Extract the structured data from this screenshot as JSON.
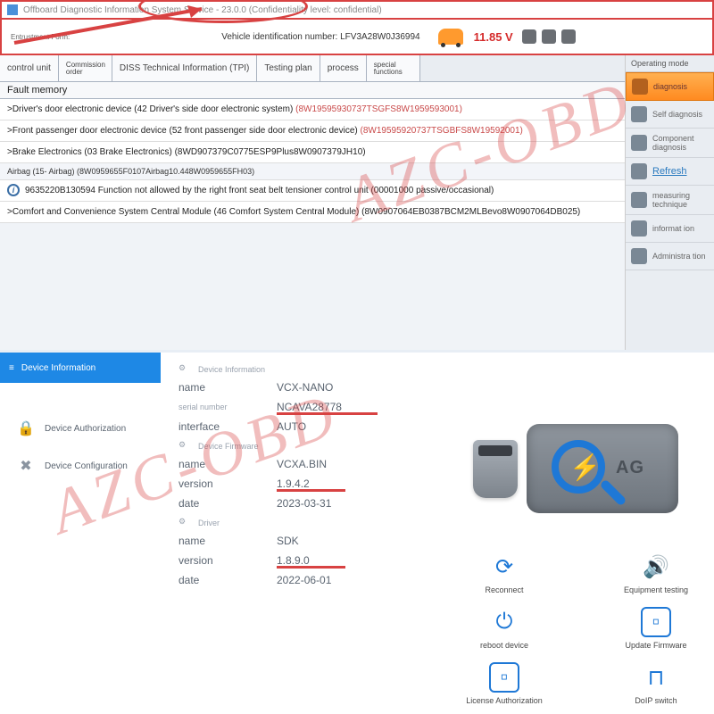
{
  "top": {
    "title": "Offboard Diagnostic Information System Service - 23.0.0 (Confidentiality level: confidential)",
    "entrust": "Entrustment Form:",
    "vin_label": "Vehicle identification number: LFV3A28W0J36994",
    "voltage": "11.85 V",
    "tabs": [
      "control unit",
      "Commission order",
      "DISS Technical Information (TPI)",
      "Testing plan",
      "process",
      "special functions"
    ],
    "section": "Fault memory",
    "faults": [
      {
        "t": ">Driver's door electronic device (42 Driver's side door electronic system) ",
        "c": "(8W19595930737TSGFS8W1959593001)"
      },
      {
        "t": ">Front passenger door electronic device (52 front passenger side door electronic device) ",
        "c": "(8W19595920737TSGBFS8W19592001)"
      },
      {
        "t": ">Brake Electronics (03 Brake Electronics) (8WD907379C0775ESP9Plus8W0907379JH10)",
        "c": ""
      }
    ],
    "airbag": "Airbag (15- Airbag) (8W0959655F0107Airbag10.448W0959655FH03)",
    "detail": "9635220B130594 Function not allowed by the right front seat belt tensioner control unit (00001000 passive/occasional)",
    "comfort": ">Comfort and Convenience System Central Module (46 Comfort System Central Module) (8W0907064EB0387BCM2MLBevo8W0907064DB025)",
    "ops_header": "Operating mode",
    "ops": [
      "diagnosis",
      "Self diagnosis",
      "Component diagnosis",
      "Refresh",
      "measuring technique",
      "informat ion",
      "Administra tion"
    ]
  },
  "bottom": {
    "header": "Device Information",
    "nav": [
      {
        "icon": "lock",
        "label": "Device Authorization"
      },
      {
        "icon": "wrench",
        "label": "Device Configuration"
      }
    ],
    "sec1": "Device Information",
    "sec2": "Device Firmware",
    "sec3": "Driver",
    "rows": {
      "name1_k": "name",
      "name1_v": "VCX-NANO",
      "serial_k": "serial number",
      "serial_v": "NCAVA28778",
      "iface_k": "interface",
      "iface_v": "AUTO",
      "name2_k": "name",
      "name2_v": "VCXA.BIN",
      "ver2_k": "version",
      "ver2_v": "1.9.4.2",
      "date2_k": "date",
      "date2_v": "2023-03-31",
      "name3_k": "name",
      "name3_v": "SDK",
      "ver3_k": "version",
      "ver3_v": "1.8.9.0",
      "date3_k": "date",
      "date3_v": "2022-06-01"
    },
    "device_label": "AG",
    "actions": [
      "Reconnect",
      "Equipment testing",
      "reboot device",
      "Update Firmware",
      "License Authorization",
      "DoIP switch"
    ]
  },
  "watermark": "AZC-OBD"
}
